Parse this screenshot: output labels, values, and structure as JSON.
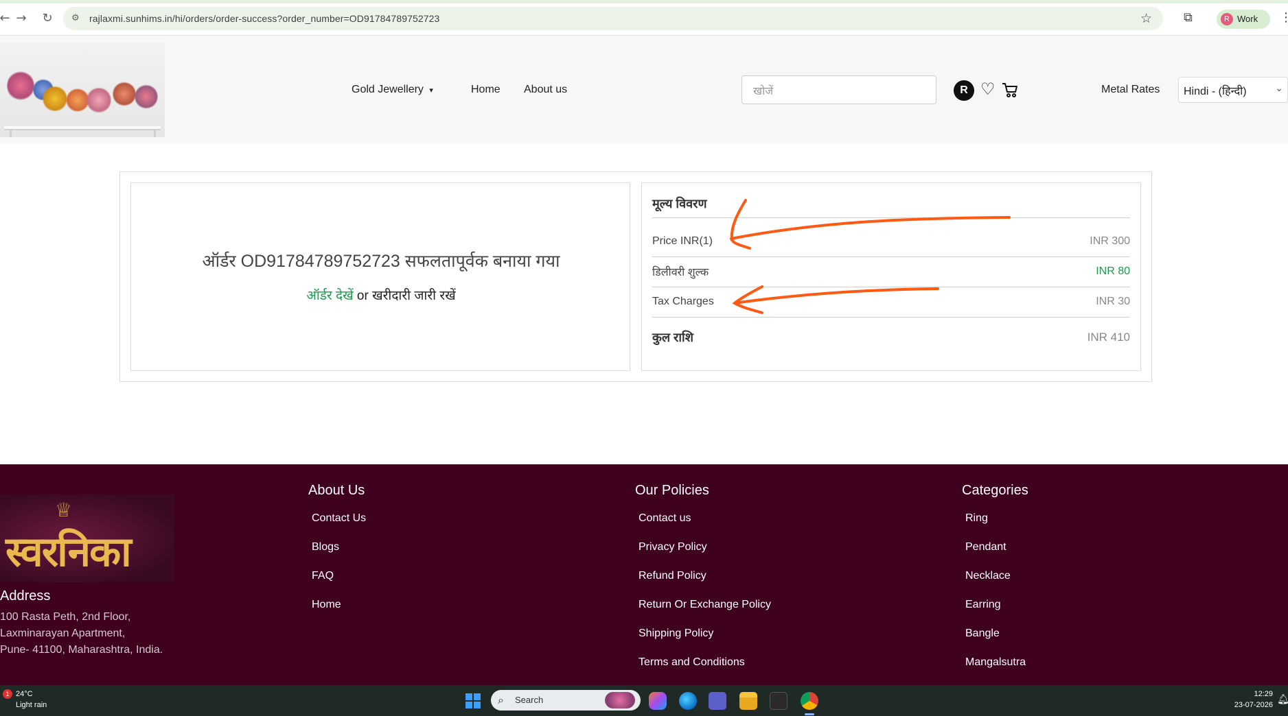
{
  "browser": {
    "url": "rajlaxmi.sunhims.in/hi/orders/order-success?order_number=OD91784789752723",
    "profile_label": "Work",
    "profile_initial": "R"
  },
  "header": {
    "nav": {
      "gold_jewellery": "Gold Jewellery",
      "home": "Home",
      "about": "About us"
    },
    "search_placeholder": "खोजें",
    "user_initial": "R",
    "metal_rates": "Metal Rates",
    "language": "Hindi - (हिन्दी)"
  },
  "order": {
    "success_message": "ऑर्डर OD91784789752723 सफलतापूर्वक बनाया गया",
    "view_order": "ऑर्डर देखें",
    "or": "or",
    "continue_shopping": "खरीदारी जारी रखें"
  },
  "price_details": {
    "title": "मूल्य विवरण",
    "rows": [
      {
        "label": "Price INR(1)",
        "value": "INR 300"
      },
      {
        "label": "डिलीवरी शुल्क",
        "value": "INR 80"
      },
      {
        "label": "Tax Charges",
        "value": "INR 30"
      }
    ],
    "total_label": "कुल राशि",
    "total_value": "INR 410"
  },
  "footer": {
    "brand": "स्वरनिका",
    "address_title": "Address",
    "address_lines": [
      "100 Rasta Peth, 2nd Floor,",
      "Laxminarayan Apartment,",
      "Pune- 41100, Maharashtra, India."
    ],
    "about": {
      "title": "About Us",
      "links": [
        "Contact Us",
        "Blogs",
        "FAQ",
        "Home"
      ]
    },
    "policies": {
      "title": "Our Policies",
      "links": [
        "Contact us",
        "Privacy Policy",
        "Refund Policy",
        "Return Or Exchange Policy",
        "Shipping Policy",
        "Terms and Conditions"
      ]
    },
    "categories": {
      "title": "Categories",
      "links": [
        "Ring",
        "Pendant",
        "Necklace",
        "Earring",
        "Bangle",
        "Mangalsutra"
      ]
    }
  },
  "taskbar": {
    "weather_badge": "1",
    "temperature": "24°C",
    "weather": "Light rain",
    "search_label": "Search",
    "time": "12:29",
    "date": "23-07-2026"
  },
  "colors": {
    "footer_bg": "#3f0020",
    "accent_green": "#1a9a4a",
    "annotation_orange": "#ff5a14"
  }
}
